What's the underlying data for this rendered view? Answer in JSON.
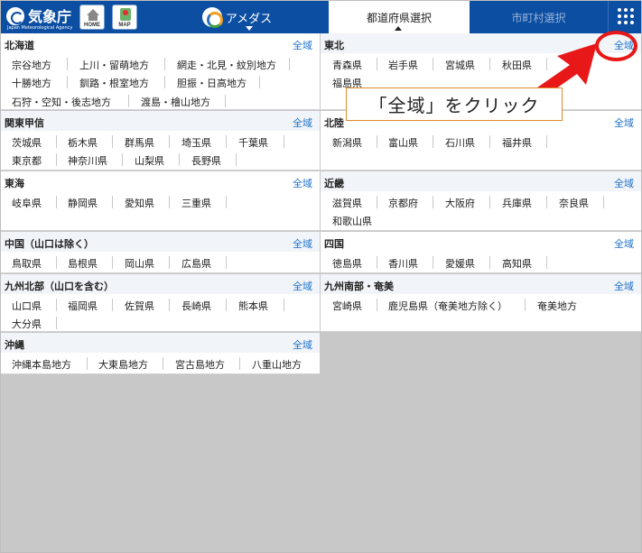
{
  "header": {
    "logo_text": "気象庁",
    "logo_sub": "Japan Meteorological Agency",
    "home_label": "HOME",
    "map_label": "MAP",
    "tab_amedas": "アメダス",
    "tab_pref": "都道府県選択",
    "tab_muni": "市町村選択"
  },
  "all_label": "全域",
  "regions": {
    "hokkaido": {
      "name": "北海道",
      "areas": [
        "宗谷地方",
        "上川・留萌地方",
        "網走・北見・紋別地方",
        "十勝地方",
        "釧路・根室地方",
        "胆振・日高地方",
        "石狩・空知・後志地方",
        "渡島・檜山地方"
      ]
    },
    "kanto": {
      "name": "関東甲信",
      "areas": [
        "茨城県",
        "栃木県",
        "群馬県",
        "埼玉県",
        "千葉県",
        "東京都",
        "神奈川県",
        "山梨県",
        "長野県"
      ]
    },
    "tokai": {
      "name": "東海",
      "areas": [
        "岐阜県",
        "静岡県",
        "愛知県",
        "三重県"
      ]
    },
    "chugoku": {
      "name": "中国（山口は除く）",
      "areas": [
        "鳥取県",
        "島根県",
        "岡山県",
        "広島県"
      ]
    },
    "kyushu_n": {
      "name": "九州北部（山口を含む）",
      "areas": [
        "山口県",
        "福岡県",
        "佐賀県",
        "長崎県",
        "熊本県",
        "大分県"
      ]
    },
    "okinawa": {
      "name": "沖縄",
      "areas": [
        "沖縄本島地方",
        "大東島地方",
        "宮古島地方",
        "八重山地方"
      ]
    },
    "tohoku": {
      "name": "東北",
      "areas": [
        "青森県",
        "岩手県",
        "宮城県",
        "秋田県",
        "福島県"
      ]
    },
    "hokuriku": {
      "name": "北陸",
      "areas": [
        "新潟県",
        "富山県",
        "石川県",
        "福井県"
      ]
    },
    "kinki": {
      "name": "近畿",
      "areas": [
        "滋賀県",
        "京都府",
        "大阪府",
        "兵庫県",
        "奈良県",
        "和歌山県"
      ]
    },
    "shikoku": {
      "name": "四国",
      "areas": [
        "徳島県",
        "香川県",
        "愛媛県",
        "高知県"
      ]
    },
    "kyushu_s": {
      "name": "九州南部・奄美",
      "areas": [
        "宮崎県",
        "鹿児島県（奄美地方除く）",
        "奄美地方"
      ]
    }
  },
  "annotation": {
    "text": "「全域」をクリック",
    "highlight_color": "#e81818"
  }
}
